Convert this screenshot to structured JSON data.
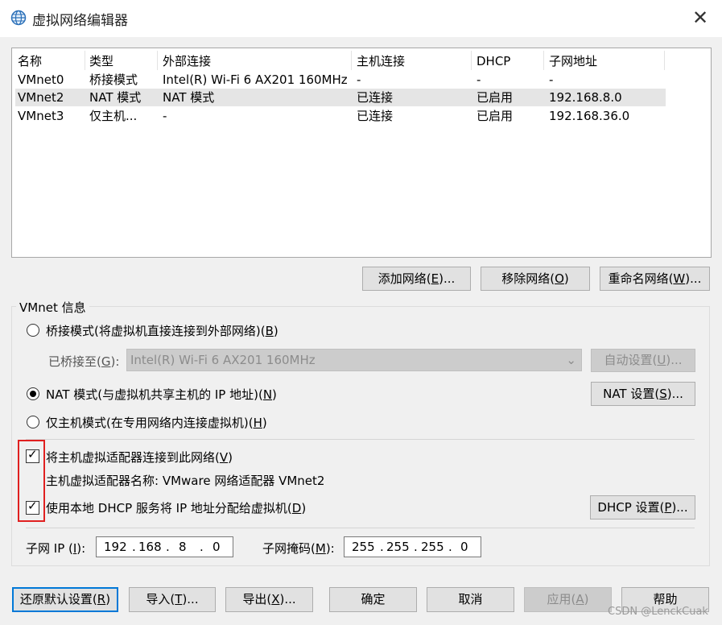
{
  "window": {
    "title": "虚拟网络编辑器",
    "icon": "globe-network-icon",
    "close_glyph": "✕"
  },
  "netlist": {
    "columns": [
      "名称",
      "类型",
      "外部连接",
      "主机连接",
      "DHCP",
      "子网地址"
    ],
    "rows": [
      {
        "name": "VMnet0",
        "type": "桥接模式",
        "external": "Intel(R) Wi-Fi 6 AX201 160MHz",
        "host": "-",
        "dhcp": "-",
        "subnet": "-"
      },
      {
        "name": "VMnet2",
        "type": "NAT 模式",
        "external": "NAT 模式",
        "host": "已连接",
        "dhcp": "已启用",
        "subnet": "192.168.8.0"
      },
      {
        "name": "VMnet3",
        "type": "仅主机...",
        "external": "-",
        "host": "已连接",
        "dhcp": "已启用",
        "subnet": "192.168.36.0"
      }
    ],
    "selected_row": "VMnet2"
  },
  "list_buttons": {
    "add": {
      "pre": "添加网络(",
      "key": "E",
      "post": ")..."
    },
    "remove": {
      "pre": "移除网络(",
      "key": "O",
      "post": ")"
    },
    "rename": {
      "pre": "重命名网络(",
      "key": "W",
      "post": ")..."
    }
  },
  "info": {
    "group_label": "VMnet 信息",
    "bridged": {
      "pre": "桥接模式(将虚拟机直接连接到外部网络)(",
      "key": "B",
      "post": ")",
      "selected": false
    },
    "bridged_to": {
      "pre": "已桥接至(",
      "key": "G",
      "post": "):",
      "value": "Intel(R) Wi-Fi 6 AX201 160MHz"
    },
    "auto_settings": {
      "pre": "自动设置(",
      "key": "U",
      "post": ")..."
    },
    "nat": {
      "pre": "NAT 模式(与虚拟机共享主机的 IP 地址)(",
      "key": "N",
      "post": ")",
      "selected": true
    },
    "nat_settings": {
      "pre": "NAT 设置(",
      "key": "S",
      "post": ")..."
    },
    "hostonly": {
      "pre": "仅主机模式(在专用网络内连接虚拟机)(",
      "key": "H",
      "post": ")",
      "selected": false
    },
    "connect_adapter": {
      "pre": "将主机虚拟适配器连接到此网络(",
      "key": "V",
      "post": ")",
      "checked": true
    },
    "adapter_name": "主机虚拟适配器名称: VMware 网络适配器 VMnet2",
    "use_dhcp": {
      "pre": "使用本地 DHCP 服务将 IP 地址分配给虚拟机(",
      "key": "D",
      "post": ")",
      "checked": true
    },
    "dhcp_settings": {
      "pre": "DHCP 设置(",
      "key": "P",
      "post": ")..."
    },
    "subnet_ip": {
      "pre": "子网 IP (",
      "key": "I",
      "post": "):",
      "octets": [
        "192",
        "168",
        "8",
        "0"
      ]
    },
    "subnet_mask": {
      "pre": "子网掩码(",
      "key": "M",
      "post": "):",
      "octets": [
        "255",
        "255",
        "255",
        "0"
      ]
    }
  },
  "bottom_buttons": {
    "restore": {
      "pre": "还原默认设置(",
      "key": "R",
      "post": ")"
    },
    "import": {
      "pre": "导入(",
      "key": "T",
      "post": ")..."
    },
    "export": {
      "pre": "导出(",
      "key": "X",
      "post": ")..."
    },
    "ok": "确定",
    "cancel": "取消",
    "apply": {
      "pre": "应用(",
      "key": "A",
      "post": ")"
    },
    "help": "帮助"
  },
  "watermark": "CSDN @LenckCuak",
  "colors": {
    "highlight": "#e02020",
    "focus": "#0078d7"
  }
}
